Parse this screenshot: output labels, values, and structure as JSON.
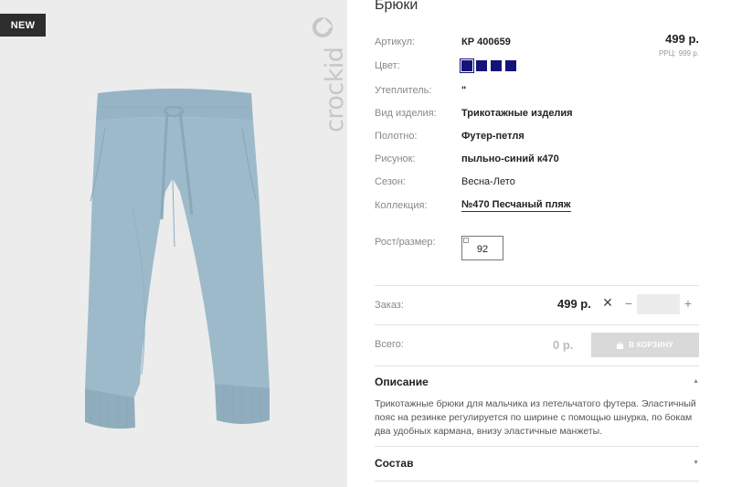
{
  "badge": "NEW",
  "brand": "crockid",
  "product": {
    "title": "Брюки",
    "price": "499 р.",
    "rrc_label": "РРЦ:",
    "rrc_price": "999 р."
  },
  "attributes": [
    {
      "label": "Артикул:",
      "value": "КР 400659"
    },
    {
      "label": "Цвет:",
      "value": ""
    },
    {
      "label": "Утеплитель:",
      "value": "\""
    },
    {
      "label": "Вид изделия:",
      "value": "Трикотажные изделия"
    },
    {
      "label": "Полотно:",
      "value": "Футер-петля"
    },
    {
      "label": "Рисунок:",
      "value": "пыльно-синий к470"
    },
    {
      "label": "Сезон:",
      "value": "Весна-Лето"
    },
    {
      "label": "Коллекция:",
      "value": "№470 Песчаный пляж"
    }
  ],
  "colors": [
    "#13137a",
    "#13137a",
    "#13137a",
    "#13137a"
  ],
  "size": {
    "label": "Рост/размер:",
    "value": "92"
  },
  "order": {
    "label": "Заказ:",
    "price": "499 р.",
    "quantity": "",
    "minus": "−",
    "plus": "+",
    "remove": "✕"
  },
  "total": {
    "label": "Всего:",
    "price": "0 р.",
    "cart_button": "В КОРЗИНУ"
  },
  "sections": {
    "description_title": "Описание",
    "description_text": "Трикотажные брюки для мальчика из петельчатого футера. Эластичный пояс на резинке регулируется по ширине с помощью шнурка, по бокам два удобных кармана, внизу эластичные манжеты.",
    "composition_title": "Состав"
  },
  "accent_color": "#13137a"
}
